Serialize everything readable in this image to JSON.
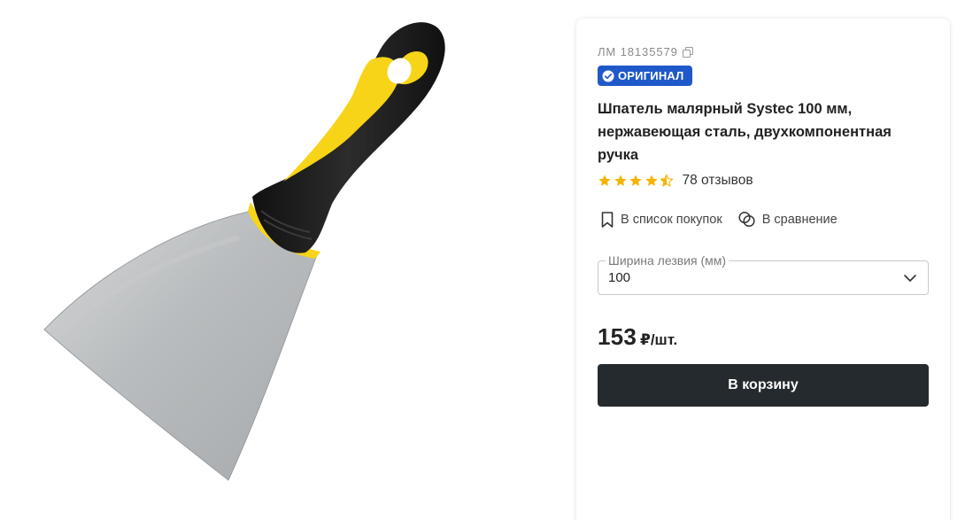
{
  "product": {
    "sku": "ЛМ 18135579",
    "badge": "ОРИГИНАЛ",
    "title": "Шпатель малярный Systec 100 мм, нержавеющая сталь, двухкомпонентная ручка",
    "rating": 4.5,
    "reviews": "78 отзывов"
  },
  "actions": {
    "shopping_list": "В список покупок",
    "compare": "В сравнение"
  },
  "option": {
    "label": "Ширина лезвия (мм)",
    "value": "100"
  },
  "price": {
    "value": "153",
    "unit": "₽/шт."
  },
  "cart_button": "В корзину",
  "icons": {
    "copy": "copy-icon",
    "verified": "check-badge-icon",
    "star": "star-icon",
    "bookmark": "bookmark-icon",
    "compare": "compare-icon",
    "chevron": "chevron-down-icon"
  },
  "colors": {
    "badge": "#1f59c9",
    "star": "#f5b400",
    "cart_button": "#242a2e",
    "handle_yellow": "#f7d417"
  }
}
